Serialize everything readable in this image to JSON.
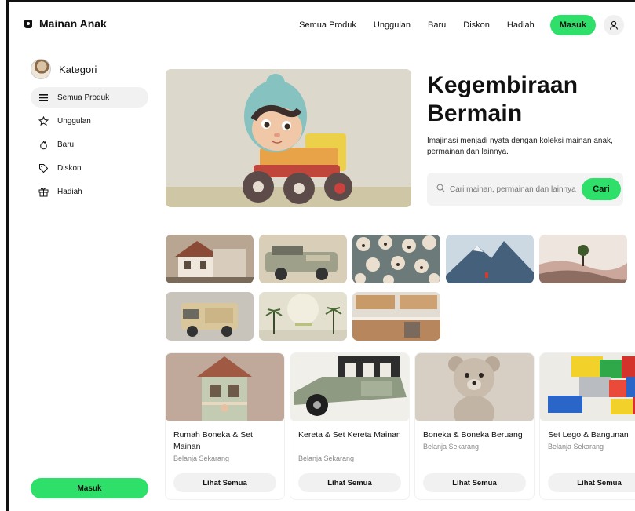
{
  "brand": {
    "name": "Mainan Anak",
    "icon": "toy-bag-icon"
  },
  "nav": {
    "links": [
      "Semua Produk",
      "Unggulan",
      "Baru",
      "Diskon",
      "Hadiah"
    ],
    "login": "Masuk",
    "user_icon": "user-icon"
  },
  "sidebar": {
    "title": "Kategori",
    "items": [
      {
        "label": "Semua Produk",
        "icon": "menu-icon",
        "active": true
      },
      {
        "label": "Unggulan",
        "icon": "star-icon",
        "active": false
      },
      {
        "label": "Baru",
        "icon": "flame-icon",
        "active": false
      },
      {
        "label": "Diskon",
        "icon": "tag-icon",
        "active": false
      },
      {
        "label": "Hadiah",
        "icon": "gift-icon",
        "active": false
      }
    ],
    "login": "Masuk"
  },
  "hero": {
    "title_line1": "Kegembiraan",
    "title_line2": "Bermain",
    "subtitle": "Imajinasi menjadi nyata dengan koleksi mainan anak, permainan dan lainnya.",
    "search_placeholder": "Cari mainan, permainan dan lainnya",
    "search_button": "Cari"
  },
  "categories": [
    {
      "name": "Rumah Boneka & Set Mainan",
      "sub": "Belanja Sekarang",
      "button": "Lihat Semua"
    },
    {
      "name": "Kereta & Set Kereta Mainan",
      "sub": "Belanja Sekarang",
      "button": "Lihat Semua"
    },
    {
      "name": "Boneka & Boneka Beruang",
      "sub": "Belanja Sekarang",
      "button": "Lihat Semua"
    },
    {
      "name": "Set Lego & Bangunan",
      "sub": "Belanja Sekarang",
      "button": "Lihat Semua"
    }
  ],
  "colors": {
    "accent": "#2ee06a",
    "soft_bg": "#f1f1f1",
    "text": "#111111"
  }
}
